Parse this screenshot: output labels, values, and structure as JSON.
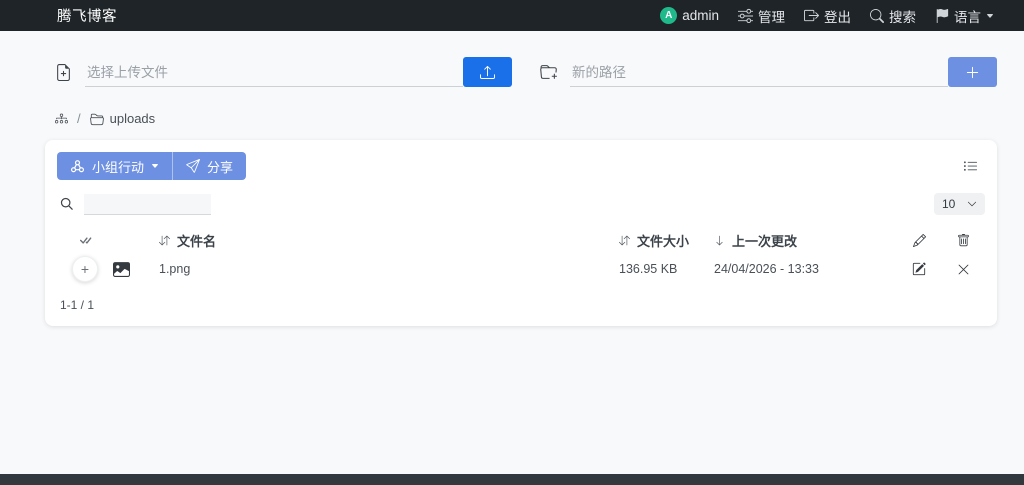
{
  "navbar": {
    "brand": "腾飞博客",
    "avatar_letter": "A",
    "user": "admin",
    "manage_label": "管理",
    "logout_label": "登出",
    "search_label": "搜索",
    "language_label": "语言"
  },
  "upload": {
    "file_placeholder": "选择上传文件",
    "file_value": "",
    "path_placeholder": "新的路径",
    "path_value": ""
  },
  "breadcrumb": {
    "separator": "/",
    "current": "uploads"
  },
  "toolbar": {
    "group_action_label": "小组行动",
    "share_label": "分享"
  },
  "search": {
    "value": ""
  },
  "page_size": {
    "value": "10"
  },
  "table": {
    "headers": {
      "name": "文件名",
      "size": "文件大小",
      "modified": "上一次更改"
    },
    "rows": [
      {
        "name": "1.png",
        "size": "136.95 KB",
        "modified": "24/04/2026 - 13:33",
        "expand_symbol": "+"
      }
    ]
  },
  "pagination": {
    "label": "1-1 / 1"
  },
  "icons": [
    "file-plus-icon",
    "upload-icon",
    "folder-plus-icon",
    "plus-icon",
    "sitemap-icon",
    "folder-open-icon",
    "group-icon",
    "send-icon",
    "caret-down-icon",
    "list-icon",
    "search-icon",
    "chevron-down-icon",
    "check-all-icon",
    "sort-icon",
    "arrow-down-icon",
    "pencil-icon",
    "trash-icon",
    "image-icon",
    "edit-square-icon",
    "x-icon",
    "sliders-icon",
    "logout-icon",
    "flag-icon"
  ],
  "colors": {
    "primary_blue": "#1a70e8",
    "light_blue": "#6e90e2",
    "avatar_green": "#1fb98b",
    "navbar_bg": "#1f2428",
    "footer_bg": "#33383d",
    "page_bg": "#f8f9fb"
  }
}
